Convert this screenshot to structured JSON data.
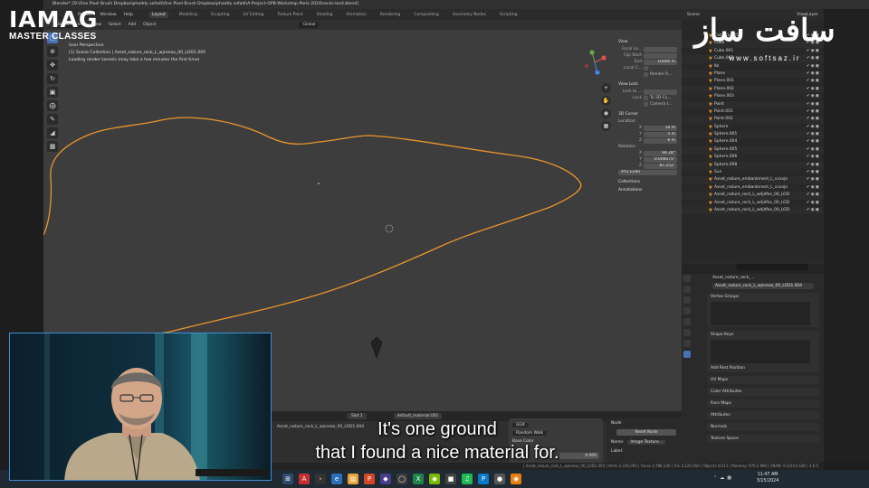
{
  "window": {
    "title": "Blender* [D:\\One Pixel Brush Dropbox\\phaddy safadi\\One Pixel Brush Dropbox\\phaddy safadi\\A-Project-OPB-Workshop-Paris-2024\\rocks-lox4.blend]"
  },
  "menubar": {
    "items": [
      "Render",
      "Window",
      "Help"
    ],
    "workspaces": [
      "Layout",
      "Modeling",
      "Sculpting",
      "UV Editing",
      "Texture Paint",
      "Shading",
      "Animation",
      "Rendering",
      "Compositing",
      "Geometry Nodes",
      "Scripting"
    ],
    "active_workspace": "Layout",
    "scene_label": "Scene",
    "viewlayer_label": "ViewLayer"
  },
  "viewport": {
    "header": {
      "mode": "Object Mode",
      "menus": [
        "View",
        "Select",
        "Add",
        "Object"
      ],
      "transform": "Global"
    },
    "overlay_lines": [
      "User Perspective",
      "(1) Scene Collection | Asset_nature_rock_L_wjnreao_00_LOD1.005",
      "Loading render kernels (may take a few minutes the first time)"
    ]
  },
  "npanel": {
    "view": {
      "title": "View",
      "focal_label": "Focal Le...",
      "clip_label": "Clip Start",
      "end_label": "End",
      "end_value": "10000 m",
      "local_label": "Local C...",
      "render_label": "Render R..."
    },
    "view_lock": {
      "title": "View Lock",
      "lock_to_label": "Lock to ...",
      "lock_label": "Lock",
      "to3d_label": "To 3D Cu...",
      "camera_label": "Camera t..."
    },
    "cursor": {
      "title": "3D Cursor",
      "location_label": "Location:",
      "loc": [
        {
          "axis": "X",
          "value": "10 m"
        },
        {
          "axis": "Y",
          "value": "5 m"
        },
        {
          "axis": "Z",
          "value": "6 m"
        }
      ],
      "rotation_label": "Rotation:",
      "rot": [
        {
          "axis": "X",
          "value": "94.28°"
        },
        {
          "axis": "Y",
          "value": "0.000075°"
        },
        {
          "axis": "Z",
          "value": "87.252°"
        }
      ],
      "mode": "XYZ Euler"
    },
    "collections_label": "Collections",
    "annotations_label": "Annotations",
    "side_tabs": [
      "Item",
      "Tool",
      "View",
      "Blendkit",
      "Sketchfab",
      "Edit",
      "3D Print",
      "Simple Addons",
      "Polygoniq"
    ]
  },
  "outliner": {
    "items": [
      "Camera.005",
      "Cube",
      "Cube.001",
      "Cube.002",
      "Ibl",
      "Plane",
      "Plane.001",
      "Plane.002",
      "Plane.003",
      "Point",
      "Point.001",
      "Point.002",
      "Sphere",
      "Sphere.001",
      "Sphere.004",
      "Sphere.005",
      "Sphere.006",
      "Sphere.008",
      "Sun",
      "Asset_nature_embankment_L_vcxxje",
      "Asset_nature_embankment_L_vcxxje",
      "Asset_nature_rock_L_wdjdfas_00_LOD",
      "Asset_nature_rock_L_wdjdfas_00_LOD",
      "Asset_nature_rock_L_wdjdfas_00_LOD"
    ]
  },
  "properties": {
    "object_name": "Asset_nature_rock_...",
    "mesh_name": "Asset_nature_rock_L_wjnreao_00_LOD1.004",
    "sections": [
      "Vertex Groups",
      "Shape Keys"
    ],
    "add_rest": "Add Rest Position",
    "collapsed": [
      "UV Maps",
      "Color Attributes",
      "Face Maps",
      "Attributes",
      "Normals",
      "Texture Space"
    ]
  },
  "shader": {
    "header_left": "Slot 1",
    "material": "default_material.001",
    "object_ref": "Asset_nature_rock_L_wjnreao_00_LOD1.004",
    "node_values": [
      "GGX",
      "Random Walk"
    ],
    "base_color_label": "Base Color",
    "value": "0.000",
    "node_panel": {
      "title": "Node",
      "reset_label": "Reset Node",
      "name_label": "Name:",
      "name_value": "Image Texture...",
      "label_label": "Label:"
    }
  },
  "statusbar": {
    "text": "| Asset_nature_rock_L_wjnreao_00_LOD1.005 | Verts 2,336,050 | Faces 3,788,136 | Tris 4,120,050 | Objects 0/113 | Memory: 976.2 MiB | VRAM: 9.3/24.0 GiB | 3.6.5"
  },
  "taskbar": {
    "time": "11:47 AM",
    "date": "3/15/2024"
  },
  "branding": {
    "logo_main": "IAMAG",
    "logo_sub": "MASTER CLASSES",
    "watermark_script": "سافت ساز",
    "watermark_site": "www.softsaz.ir"
  },
  "subtitle": {
    "line1": "It's one ground",
    "line2": "that I found a nice material for."
  },
  "colors": {
    "selection_outline": "#e8952d",
    "webcam_border": "#3b8fd9",
    "active_tool": "#4772b3"
  }
}
